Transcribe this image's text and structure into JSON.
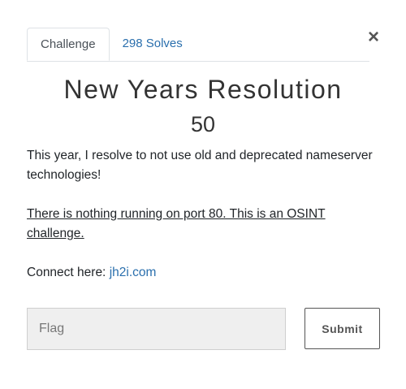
{
  "modal": {
    "close_label": "×",
    "tabs": [
      {
        "label": "Challenge"
      },
      {
        "label": "298 Solves"
      }
    ],
    "challenge": {
      "name": "New Years Resolution",
      "value": "50",
      "description_line1": "This year, I resolve to not use old and deprecated nameserver technologies!",
      "description_line2": "There is nothing running on port 80. This is an OSINT challenge.",
      "connect_prefix": "Connect here: ",
      "connect_link": "jh2i.com"
    },
    "flag_input": {
      "placeholder": "Flag",
      "value": ""
    },
    "submit_label": "Submit"
  },
  "colors": {
    "link": "#2a6fad",
    "input_bg": "#efefef"
  }
}
